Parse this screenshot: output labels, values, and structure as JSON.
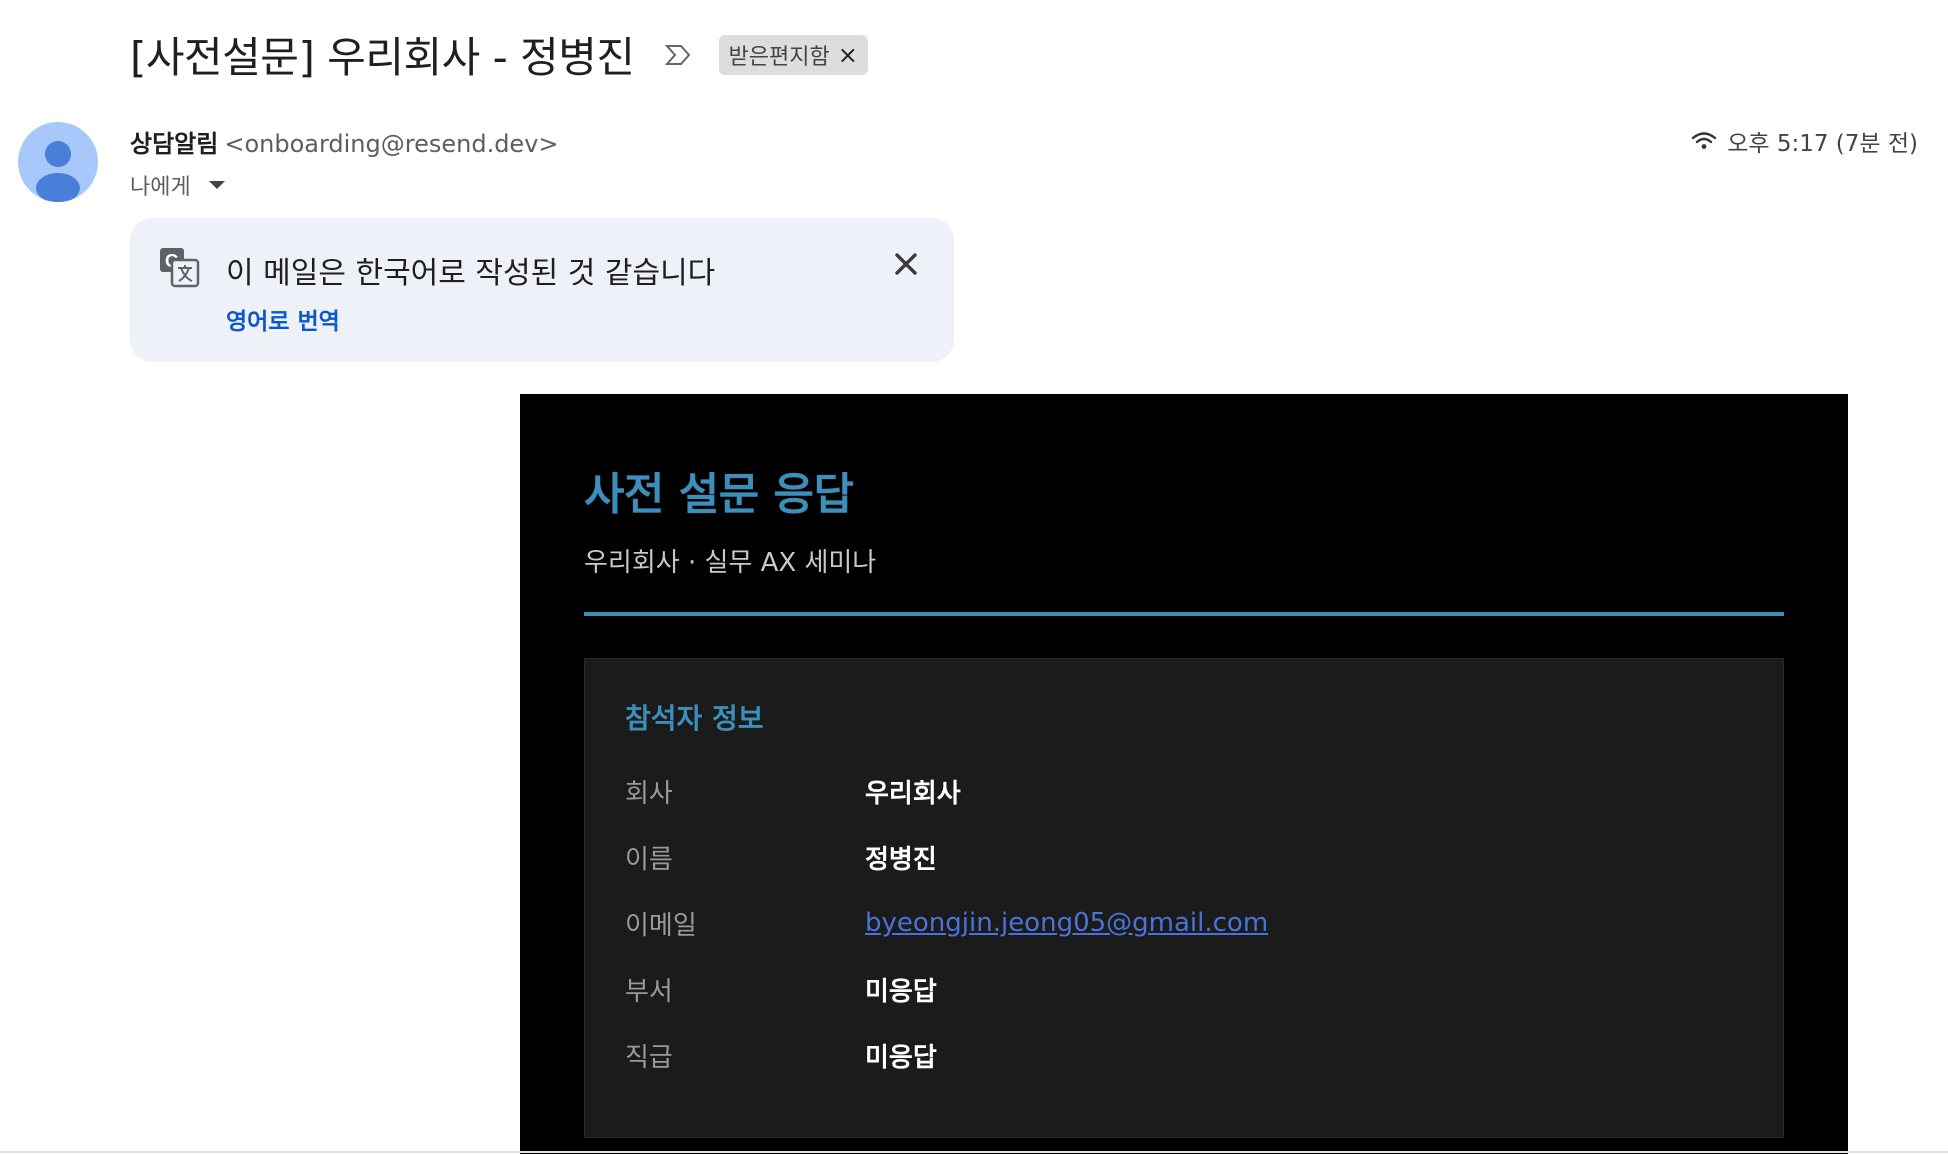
{
  "email": {
    "subject": "[사전설문] 우리회사 - 정병진",
    "label_chip": "받은편지함",
    "sender_name": "상담알림",
    "sender_email": "<onboarding@resend.dev>",
    "recipient_label": "나에게",
    "time": "오후 5:17 (7분 전)"
  },
  "translate": {
    "message": "이 메일은 한국어로 작성된 것 같습니다",
    "action": "영어로 번역"
  },
  "survey": {
    "title": "사전 설문 응답",
    "subtitle": "우리회사 · 실무 AX 세미나",
    "section_heading": "참석자 정보",
    "rows": [
      {
        "label": "회사",
        "value": "우리회사"
      },
      {
        "label": "이름",
        "value": "정병진"
      },
      {
        "label": "이메일",
        "value": "byeongjin.jeong05@gmail.com"
      },
      {
        "label": "부서",
        "value": "미응답"
      },
      {
        "label": "직급",
        "value": "미응답"
      }
    ]
  },
  "colors": {
    "accent": "#3b8fba",
    "link": "#0b57d0",
    "email_link": "#4a72d8",
    "body_background": "#000000",
    "card_background": "#1b1b1b",
    "translate_background": "#eef2f8"
  },
  "icons": [
    "important-marker-icon",
    "chip-close-icon",
    "avatar-icon",
    "caret-down-icon",
    "signal-icon",
    "google-translate-icon",
    "close-icon"
  ]
}
